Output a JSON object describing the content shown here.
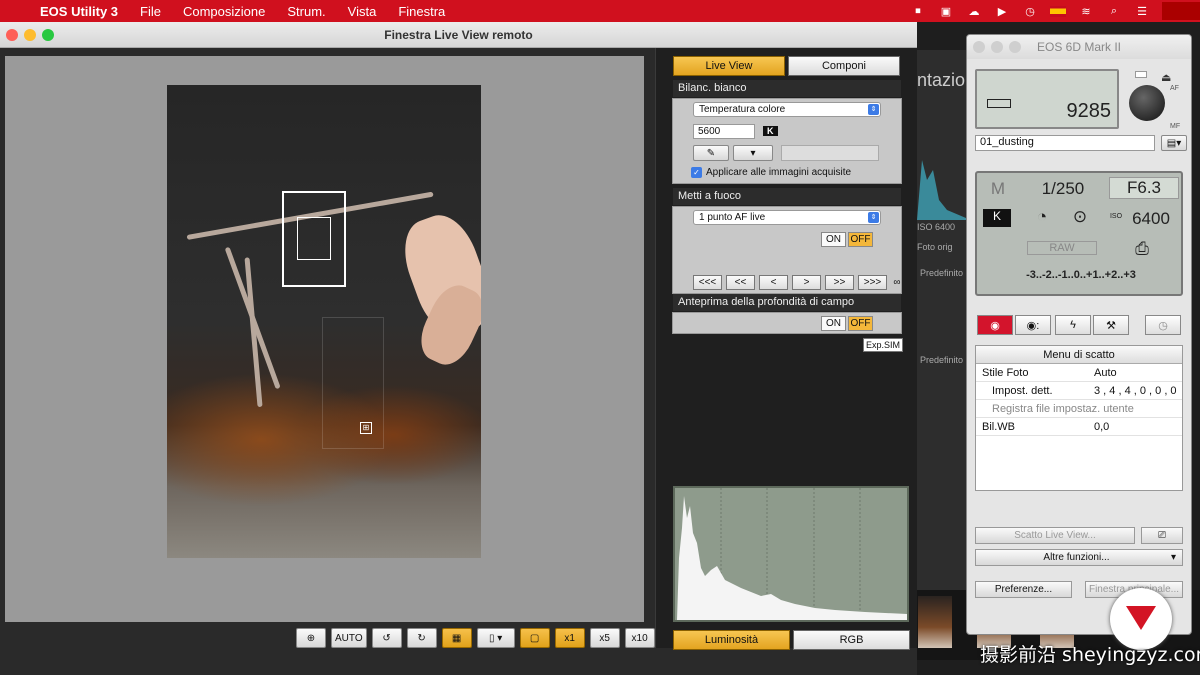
{
  "menubar": {
    "app": "EOS Utility 3",
    "items": [
      "File",
      "Composizione",
      "Strum.",
      "Vista",
      "Finestra"
    ]
  },
  "liveview": {
    "title": "Finestra Live View remoto",
    "tabs": {
      "liveview": "Live View",
      "compose": "Componi"
    },
    "wb": {
      "header": "Bilanc. bianco",
      "mode": "Temperatura colore",
      "kelvin": "5600",
      "k_label": "K",
      "apply": "Applicare alle immagini acquisite"
    },
    "focus": {
      "header": "Metti a fuoco",
      "mode": "1 punto AF live",
      "on": "ON",
      "off": "OFF",
      "nav": [
        "<<<",
        "<<",
        "<",
        ">",
        ">>",
        ">>>"
      ],
      "infinity": "∞"
    },
    "dof": {
      "header": "Anteprima della profondità di campo",
      "on": "ON",
      "off": "OFF",
      "exp": "Exp.SIM"
    },
    "histogram": {
      "lum": "Luminosità",
      "rgb": "RGB"
    },
    "toolbar": {
      "auto": "AUTO",
      "x1": "x1",
      "x5": "x5",
      "x10": "x10"
    }
  },
  "peek": {
    "ntazion": "ntazion",
    "iso": "ISO 6400",
    "foto": "Foto orig",
    "pred1": "Predefinito",
    "pred2": "Predefinito"
  },
  "camera": {
    "title": "EOS 6D Mark II",
    "shots": "9285",
    "filename": "01_dusting",
    "af": "AF",
    "mf": "MF",
    "mode": "M",
    "shutter": "1/250",
    "aperture": "F6.3",
    "k": "K",
    "iso_label": "ISO",
    "iso": "6400",
    "raw": "RAW",
    "exposure_scale": "-3..-2..-1..0..+1..+2..+3",
    "menu_title": "Menu di scatto",
    "menu": [
      {
        "k": "Stile Foto",
        "v": "Auto"
      },
      {
        "k": "Impost. dett.",
        "v": "3 , 4 , 4 , 0 , 0 , 0"
      },
      {
        "k": "Registra file impostaz. utente",
        "v": ""
      },
      {
        "k": "Bil.WB",
        "v": "0,0"
      }
    ],
    "btn_lv": "Scatto Live View...",
    "btn_other": "Altre funzioni...",
    "btn_pref": "Preferenze...",
    "btn_main": "Finestra principale..."
  },
  "watermark": "摄影前沿 sheyingzyz.com"
}
